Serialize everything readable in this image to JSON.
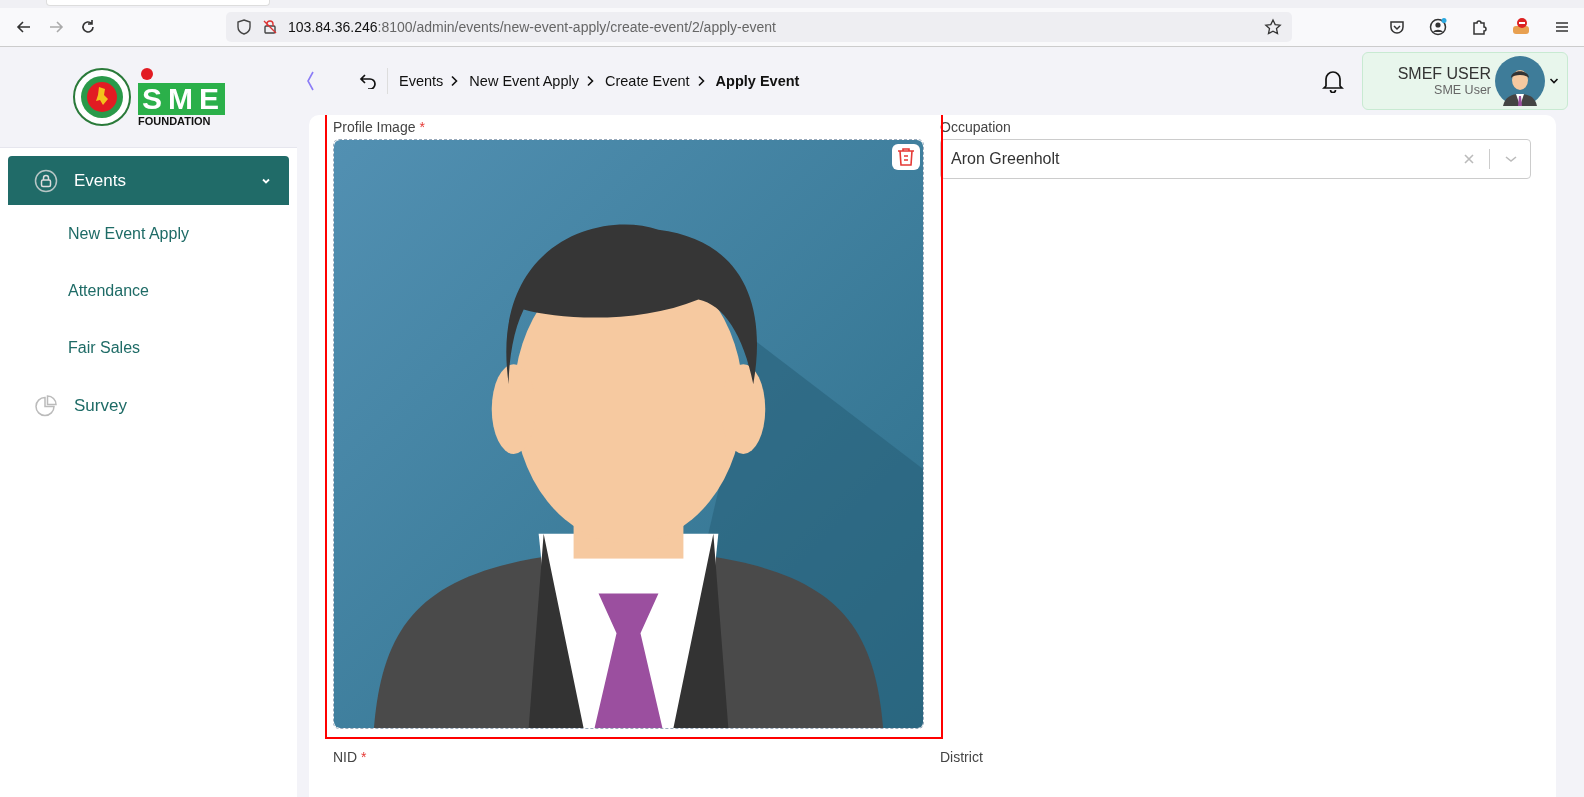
{
  "browser": {
    "url_host": "103.84.36.246",
    "url_rest": ":8100/admin/events/new-event-apply/create-event/2/apply-event"
  },
  "logo": {
    "name": "SME",
    "caption": "FOUNDATION"
  },
  "breadcrumb": [
    {
      "label": "Events",
      "current": false
    },
    {
      "label": "New Event Apply",
      "current": false
    },
    {
      "label": "Create Event",
      "current": false
    },
    {
      "label": "Apply Event",
      "current": true
    }
  ],
  "user": {
    "name": "SMEF USER",
    "role": "SME User"
  },
  "sidebar": {
    "items": [
      {
        "label": "Events",
        "kind": "group",
        "expanded": true,
        "selected": true,
        "children": [
          {
            "label": "New Event Apply"
          },
          {
            "label": "Attendance"
          },
          {
            "label": "Fair Sales"
          }
        ]
      },
      {
        "label": "Survey",
        "kind": "item",
        "selected": false
      }
    ]
  },
  "form": {
    "fields": [
      {
        "label": "Profile Image",
        "marker": "*",
        "kind": "image"
      },
      {
        "label": "Occupation",
        "kind": "select",
        "value": "Aron Greenholt"
      },
      {
        "label": "NID",
        "marker": "*",
        "kind": "text"
      },
      {
        "label": "District",
        "kind": "text"
      }
    ]
  }
}
